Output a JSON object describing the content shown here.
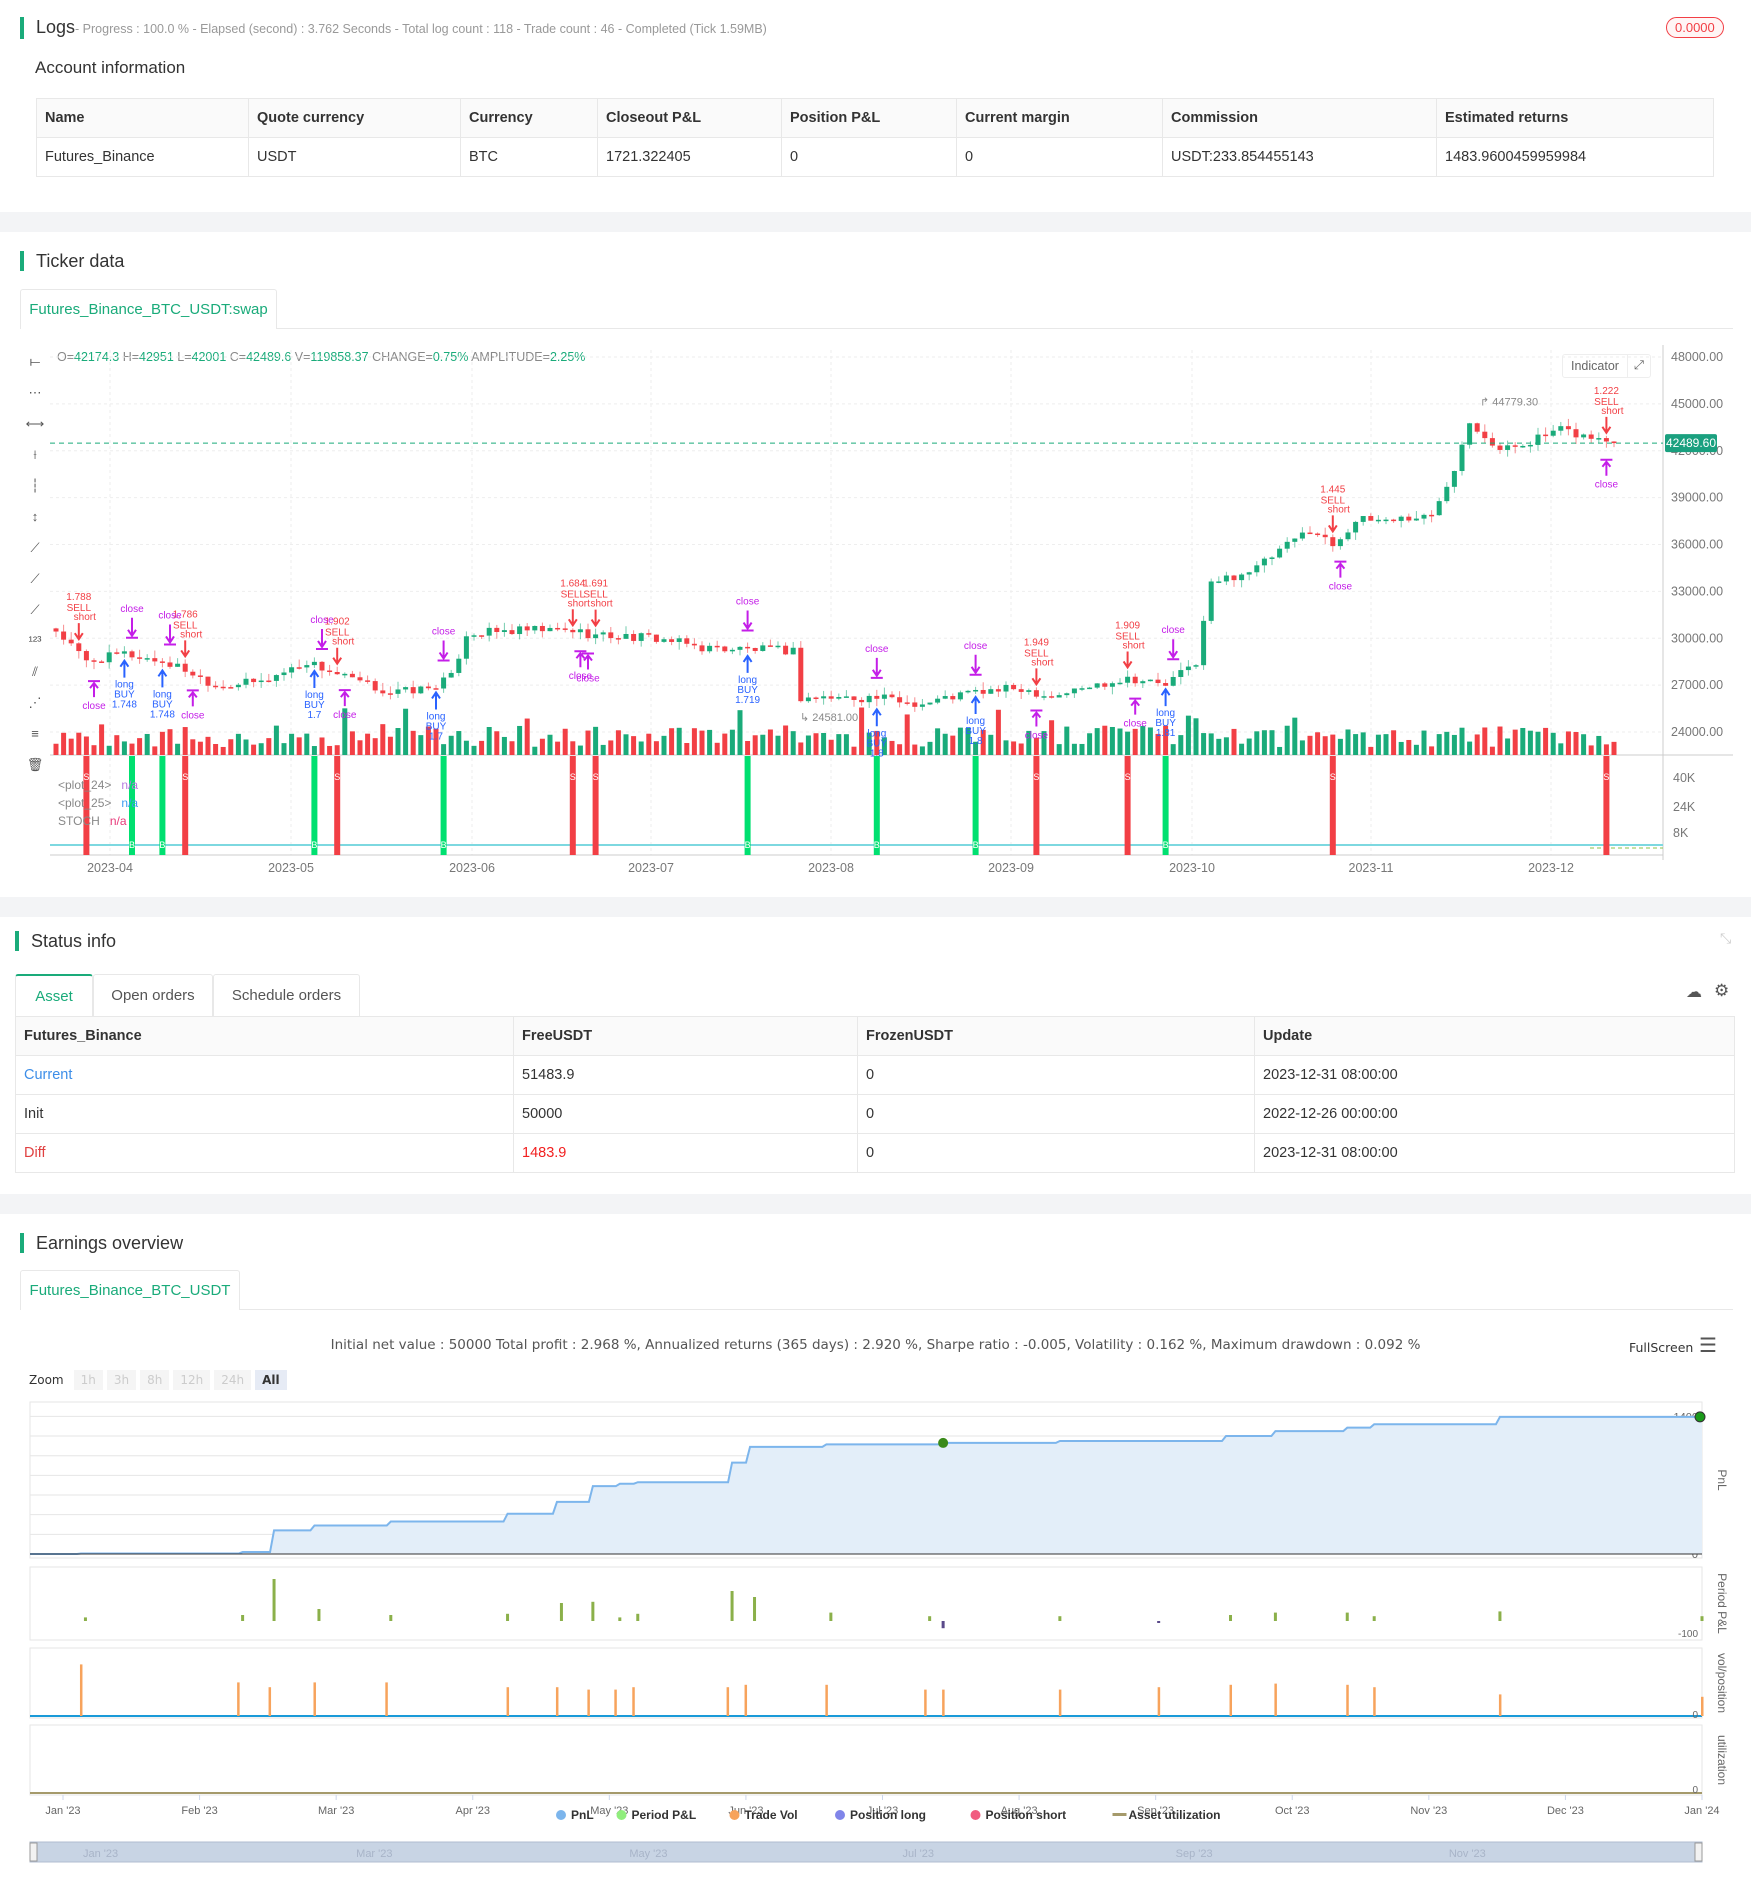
{
  "logs": {
    "title": "Logs",
    "summary": "- Progress : 100.0 % - Elapsed (second) : 3.762  Seconds - Total log count : 118 - Trade count : 46 - Completed (Tick 1.59MB)",
    "badge": "0.0000"
  },
  "account": {
    "title": "Account information",
    "columns": [
      "Name",
      "Quote currency",
      "Currency",
      "Closeout P&L",
      "Position P&L",
      "Current margin",
      "Commission",
      "Estimated returns"
    ],
    "row": [
      "Futures_Binance",
      "USDT",
      "BTC",
      "1721.322405",
      "0",
      "0",
      "USDT:233.854455143",
      "1483.9600459959984"
    ]
  },
  "ticker": {
    "title": "Ticker data",
    "tab": "Futures_Binance_BTC_USDT:swap",
    "ohlc": {
      "o_label": "O=",
      "o": "42174.3",
      "h_label": " H=",
      "h": "42951",
      "l_label": " L=",
      "l": "42001",
      "c_label": " C=",
      "c": "42489.6",
      "v_label": " V=",
      "v": "119858.37",
      "chg_label": " CHANGE=",
      "chg": "0.75%",
      "amp_label": " AMPLITUDE=",
      "amp": "2.25%"
    },
    "indicator_btn": "Indicator",
    "current_price": "42489.60",
    "high_label": "44779.30",
    "low_label": "24581.00",
    "price_ticks": [
      "48000.00",
      "45000.00",
      "42000.00",
      "39000.00",
      "36000.00",
      "33000.00",
      "30000.00",
      "27000.00",
      "24000.00"
    ],
    "ind_ticks": [
      "40K",
      "24K",
      "8K"
    ],
    "date_ticks": [
      "2023-04",
      "2023-05",
      "2023-06",
      "2023-07",
      "2023-08",
      "2023-09",
      "2023-10",
      "2023-11",
      "2023-12"
    ],
    "legend": [
      {
        "name": "<plot_24>",
        "value": "n/a",
        "color": "#b57be0"
      },
      {
        "name": "<plot_25>",
        "value": "n/a",
        "color": "#3d9cf0"
      },
      {
        "name": "STOCH",
        "value": "n/a",
        "color": "#e83a7a"
      }
    ],
    "colors": {
      "up": "#1aab7a",
      "down": "#f23f45",
      "buy": "#2962ff",
      "close": "#c41ee8"
    }
  },
  "chart_data": [
    {
      "type": "candlestick",
      "title": "Futures_Binance_BTC_USDT:swap",
      "ylim": [
        24000,
        48000
      ],
      "candle_count": 206,
      "close_anchors": [
        [
          0,
          30500
        ],
        [
          4,
          28500
        ],
        [
          9,
          29000
        ],
        [
          14,
          28500
        ],
        [
          17,
          28000
        ],
        [
          21,
          27000
        ],
        [
          27,
          27200
        ],
        [
          33,
          28500
        ],
        [
          38,
          27500
        ],
        [
          44,
          26500
        ],
        [
          49,
          26800
        ],
        [
          52,
          27500
        ],
        [
          54,
          30300
        ],
        [
          62,
          30500
        ],
        [
          68,
          30500
        ],
        [
          71,
          30200
        ],
        [
          79,
          30000
        ],
        [
          85,
          29400
        ],
        [
          97,
          29200
        ],
        [
          98,
          26200
        ],
        [
          108,
          26200
        ],
        [
          114,
          25800
        ],
        [
          120,
          26500
        ],
        [
          127,
          26800
        ],
        [
          131,
          26300
        ],
        [
          141,
          27500
        ],
        [
          146,
          27000
        ],
        [
          150,
          28500
        ],
        [
          152,
          33500
        ],
        [
          158,
          34500
        ],
        [
          165,
          37000
        ],
        [
          168,
          36000
        ],
        [
          171,
          37500
        ],
        [
          181,
          37800
        ],
        [
          184,
          41000
        ],
        [
          186,
          44000
        ],
        [
          190,
          42000
        ],
        [
          198,
          43300
        ],
        [
          205,
          42489.6
        ]
      ],
      "markers": [
        {
          "i": 3,
          "kind": "sell",
          "value": "1.788",
          "label": "SELL",
          "tag": "short"
        },
        {
          "i": 17,
          "kind": "sell",
          "value": "1.786",
          "label": "SELL",
          "tag": "short"
        },
        {
          "i": 37,
          "kind": "sell",
          "value": "1.902",
          "label": "SELL",
          "tag": "short"
        },
        {
          "i": 68,
          "kind": "sell",
          "value": "1.684",
          "label": "SELL",
          "tag": "short"
        },
        {
          "i": 71,
          "kind": "sell",
          "value": "1.691",
          "label": "SELL",
          "tag": "short"
        },
        {
          "i": 129,
          "kind": "sell",
          "value": "1.949",
          "label": "SELL",
          "tag": "short"
        },
        {
          "i": 141,
          "kind": "sell",
          "value": "1.909",
          "label": "SELL",
          "tag": "short"
        },
        {
          "i": 168,
          "kind": "sell",
          "value": "1.445",
          "label": "SELL",
          "tag": "short"
        },
        {
          "i": 204,
          "kind": "sell",
          "value": "1.222",
          "label": "SELL",
          "tag": "short"
        },
        {
          "i": 9,
          "kind": "buy",
          "value": "1.748",
          "label": "BUY",
          "tag": "long"
        },
        {
          "i": 14,
          "kind": "buy",
          "value": "1.748",
          "label": "BUY",
          "tag": "long"
        },
        {
          "i": 34,
          "kind": "buy",
          "value": "1.7",
          "label": "BUY",
          "tag": "long"
        },
        {
          "i": 50,
          "kind": "buy",
          "value": "1.7",
          "label": "BUY",
          "tag": "long"
        },
        {
          "i": 91,
          "kind": "buy",
          "value": "1.719",
          "label": "BUY",
          "tag": "long"
        },
        {
          "i": 108,
          "kind": "buy",
          "value": "1.8",
          "label": "BUY",
          "tag": "long"
        },
        {
          "i": 121,
          "kind": "buy",
          "value": "1.8",
          "label": "BUY",
          "tag": "long"
        },
        {
          "i": 146,
          "kind": "buy",
          "value": "1.81",
          "label": "BUY",
          "tag": "long"
        },
        {
          "i": 10,
          "kind": "close_top",
          "label": "close"
        },
        {
          "i": 15,
          "kind": "close_top",
          "label": "close"
        },
        {
          "i": 35,
          "kind": "close_top",
          "label": "close"
        },
        {
          "i": 51,
          "kind": "close_top",
          "label": "close"
        },
        {
          "i": 91,
          "kind": "close_top",
          "label": "close"
        },
        {
          "i": 108,
          "kind": "close_top",
          "label": "close"
        },
        {
          "i": 121,
          "kind": "close_top",
          "label": "close"
        },
        {
          "i": 147,
          "kind": "close_top",
          "label": "close"
        },
        {
          "i": 5,
          "kind": "close_bottom",
          "label": "close"
        },
        {
          "i": 18,
          "kind": "close_bottom",
          "label": "close"
        },
        {
          "i": 38,
          "kind": "close_bottom",
          "label": "close"
        },
        {
          "i": 69,
          "kind": "close_bottom",
          "label": "close"
        },
        {
          "i": 70,
          "kind": "close_bottom",
          "label": "close"
        },
        {
          "i": 129,
          "kind": "close_bottom",
          "label": "close"
        },
        {
          "i": 142,
          "kind": "close_bottom",
          "label": "close"
        },
        {
          "i": 169,
          "kind": "close_bottom",
          "label": "close"
        },
        {
          "i": 204,
          "kind": "close_bottom",
          "label": "close"
        }
      ],
      "signals_S": [
        4,
        17,
        37,
        68,
        71,
        129,
        141,
        168,
        204
      ],
      "signals_B": [
        10,
        14,
        34,
        51,
        91,
        108,
        121,
        146
      ],
      "signal_labels": {
        "S": "S",
        "B": "B"
      }
    },
    {
      "type": "line",
      "title": "PnL",
      "ylim": [
        0,
        1400
      ],
      "yticks": [
        0,
        200,
        400,
        600,
        800,
        1000,
        1200,
        1400
      ],
      "x_days": [
        0,
        4,
        40,
        47,
        56,
        73,
        99,
        110,
        118,
        124,
        128,
        149,
        153,
        170,
        196,
        222,
        259,
        270,
        286,
        292,
        320,
        365
      ],
      "values": [
        0,
        5,
        20,
        240,
        290,
        330,
        410,
        530,
        690,
        715,
        730,
        930,
        1090,
        1115,
        1130,
        1150,
        1200,
        1250,
        1285,
        1320,
        1395,
        1395
      ],
      "highlight_day": 196
    },
    {
      "type": "bar",
      "title": "Period P&L",
      "ytick": "-100",
      "x_days": [
        5,
        40,
        47,
        57,
        73,
        99,
        111,
        118,
        124,
        128,
        149,
        154,
        171,
        193,
        196,
        222,
        244,
        260,
        270,
        286,
        292,
        320,
        365
      ],
      "values": [
        30,
        50,
        350,
        100,
        50,
        60,
        150,
        160,
        30,
        60,
        250,
        200,
        70,
        40,
        -60,
        40,
        -10,
        50,
        70,
        70,
        40,
        80,
        40
      ]
    },
    {
      "type": "bar",
      "title": "vol/position",
      "ytick": "0",
      "x_days": [
        4,
        39,
        46,
        56,
        72,
        99,
        110,
        117,
        123,
        127,
        148,
        152,
        170,
        192,
        196,
        222,
        244,
        260,
        270,
        286,
        292,
        320,
        365
      ],
      "values": [
        43,
        28,
        24,
        28,
        28,
        24,
        24,
        22,
        22,
        24,
        24,
        26,
        26,
        22,
        22,
        22,
        24,
        26,
        27,
        26,
        24,
        18,
        16
      ]
    },
    {
      "type": "line",
      "title": "utilization",
      "ytick": "0",
      "values": [
        0
      ]
    }
  ],
  "status": {
    "title": "Status info",
    "tabs": [
      "Asset",
      "Open orders",
      "Schedule orders"
    ],
    "columns": [
      "Futures_Binance",
      "FreeUSDT",
      "FrozenUSDT",
      "Update"
    ],
    "rows": [
      [
        "Current",
        "51483.9",
        "0",
        "2023-12-31 08:00:00"
      ],
      [
        "Init",
        "50000",
        "0",
        "2022-12-26 00:00:00"
      ],
      [
        "Diff",
        "1483.9",
        "0",
        "2023-12-31 08:00:00"
      ]
    ]
  },
  "earnings": {
    "title": "Earnings overview",
    "tab": "Futures_Binance_BTC_USDT",
    "stats": "Initial net value : 50000 Total profit : 2.968 %, Annualized returns (365 days) : 2.920 %, Sharpe ratio : -0.005, Volatility : 0.162 %, Maximum drawdown : 0.092 %",
    "fullscreen": "FullScreen",
    "zoom_label": "Zoom",
    "zoom_opts": [
      "1h",
      "3h",
      "8h",
      "12h",
      "24h",
      "All"
    ],
    "pane_titles": [
      "PnL",
      "Period P&L",
      "vol/position",
      "utilization"
    ],
    "x_ticks": [
      "Jan '23",
      "Feb '23",
      "Mar '23",
      "Apr '23",
      "May '23",
      "Jun '23",
      "Jul '23",
      "Aug '23",
      "Sep '23",
      "Oct '23",
      "Nov '23",
      "Dec '23",
      "Jan '24"
    ],
    "nav_ticks": [
      "Jan '23",
      "Mar '23",
      "May '23",
      "Jul '23",
      "Sep '23",
      "Nov '23"
    ],
    "legend": [
      {
        "name": "PnL",
        "color": "#7cb5ec"
      },
      {
        "name": "Period P&L",
        "color": "#90ed7d"
      },
      {
        "name": "Trade Vol",
        "color": "#f7a35c"
      },
      {
        "name": "Position long",
        "color": "#8085e9"
      },
      {
        "name": "Position short",
        "color": "#f15c80"
      },
      {
        "name": "Asset utilization",
        "color": "#a59a6b"
      }
    ]
  }
}
